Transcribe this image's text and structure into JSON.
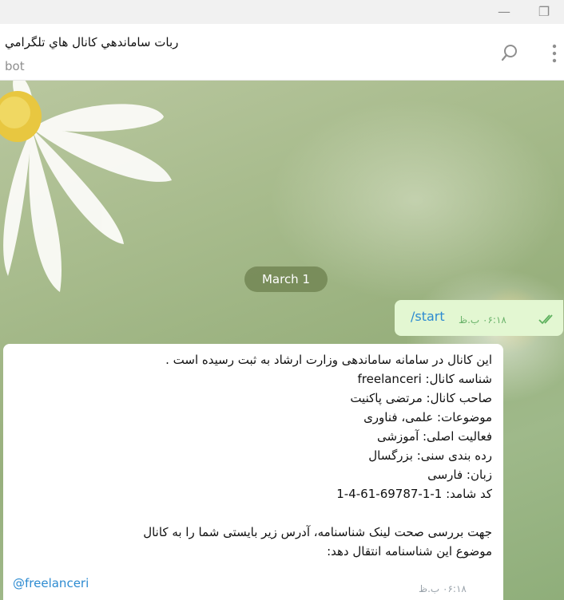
{
  "window": {
    "minimize_glyph": "—",
    "maximize_glyph": "❐"
  },
  "header": {
    "title": "ربات ساماندهي كانال هاي تلگرامي",
    "subtitle": "bot"
  },
  "chat": {
    "date_label": "March 1",
    "outgoing": {
      "text": "/start",
      "time": "۰۶:۱۸ ب.ظ"
    },
    "incoming": {
      "lines": [
        "این کانال در سامانه ساماندهی وزارت ارشاد به ثبت رسیده است .",
        "شناسه کانال: freelanceri",
        "صاحب کانال: مرتضی پاکنیت",
        "موضوعات: علمی، فناوری",
        "فعالیت اصلی: آموزشی",
        "رده بندی سنی: بزرگسال",
        "زبان: فارسی",
        "کد شامد: 1-1-69787-61-4-1",
        "",
        "جهت بررسی صحت لینک شناسنامه، آدرس زیر بایستی شما را به کانال",
        "موضوع این شناسنامه انتقال دهد:"
      ],
      "link": "@freelanceri",
      "time": "۰۶:۱۸ ب.ظ"
    }
  },
  "colors": {
    "outgoing_bubble": "#e3f7d2",
    "link": "#2d8bd1",
    "date_pill": "#6e8250"
  }
}
